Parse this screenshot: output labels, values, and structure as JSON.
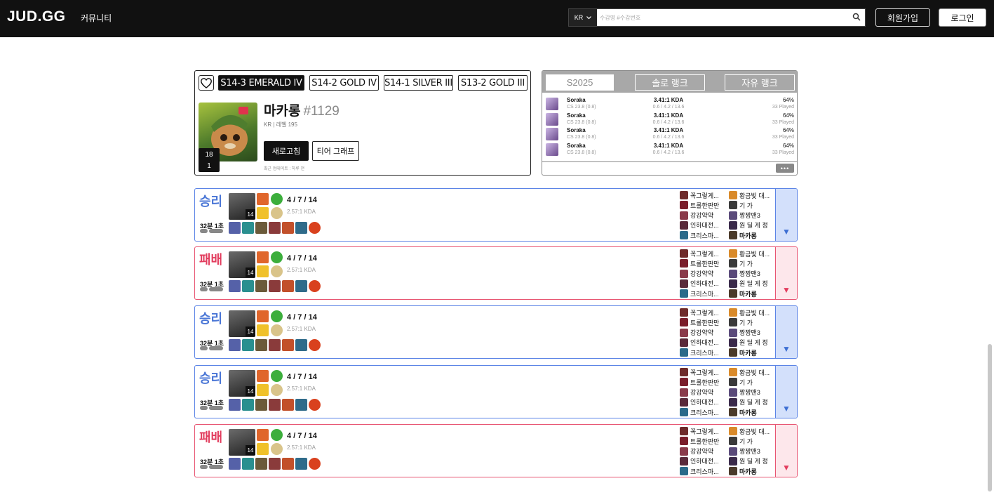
{
  "header": {
    "logo": "JUD.GG",
    "community": "커뮤니티",
    "region": "KR",
    "search_placeholder": "수감명 #수감번호",
    "signup": "회원가입",
    "login": "로그인"
  },
  "profile": {
    "tiers": [
      "S14-3 EMERALD IV",
      "S14-2 GOLD IV",
      "S14-1 SILVER III",
      "S13-2 GOLD III"
    ],
    "name": "마카롱",
    "tag": "#1129",
    "meta": "KR | 레벨 195",
    "level_top": "18",
    "level_bottom": "1",
    "refresh": "새로고침",
    "tier_graph": "티어 그래프",
    "updated": "최근 업데이트 : 하루 전"
  },
  "ranks": {
    "tabs": [
      "S2025",
      "솔로 랭크",
      "자유 랭크"
    ],
    "more": "•••",
    "champions": [
      {
        "name": "Soraka",
        "cs": "CS 23.8 (0.8)",
        "kda": "3.41:1 KDA",
        "kda_detail": "0.6 / 4.2 / 13.6",
        "winrate": "64%",
        "played": "33 Played"
      },
      {
        "name": "Soraka",
        "cs": "CS 23.8 (0.8)",
        "kda": "3.41:1 KDA",
        "kda_detail": "0.6 / 4.2 / 13.6",
        "winrate": "64%",
        "played": "33 Played"
      },
      {
        "name": "Soraka",
        "cs": "CS 23.8 (0.8)",
        "kda": "3.41:1 KDA",
        "kda_detail": "0.6 / 4.2 / 13.6",
        "winrate": "64%",
        "played": "33 Played"
      },
      {
        "name": "Soraka",
        "cs": "CS 23.8 (0.8)",
        "kda": "3.41:1 KDA",
        "kda_detail": "0.6 / 4.2 / 13.6",
        "winrate": "64%",
        "played": "33 Played"
      }
    ]
  },
  "matches": [
    {
      "result": "승리",
      "type": "win",
      "duration": "32분 1초",
      "champ_level": "14",
      "kda": "4 / 7 / 14",
      "ratio": "2.57:1 KDA",
      "toggle": "▼"
    },
    {
      "result": "패배",
      "type": "loss",
      "duration": "32분 1초",
      "champ_level": "14",
      "kda": "4 / 7 / 14",
      "ratio": "2.57:1 KDA",
      "toggle": "▼"
    },
    {
      "result": "승리",
      "type": "win",
      "duration": "32분 1초",
      "champ_level": "14",
      "kda": "4 / 7 / 14",
      "ratio": "2.57:1 KDA",
      "toggle": "▼"
    },
    {
      "result": "승리",
      "type": "win",
      "duration": "32분 1초",
      "champ_level": "14",
      "kda": "4 / 7 / 14",
      "ratio": "2.57:1 KDA",
      "toggle": "▼"
    },
    {
      "result": "패배",
      "type": "loss",
      "duration": "32분 1초",
      "champ_level": "14",
      "kda": "4 / 7 / 14",
      "ratio": "2.57:1 KDA",
      "toggle": "▼"
    }
  ],
  "team_blue": [
    "꼭그렇게...",
    "트롤한판만",
    "강강약약",
    "인하대전...",
    "크리스마..."
  ],
  "team_red": [
    "황금빛 대...",
    "기 가",
    "짱짱맨3",
    "원 딜 게 정",
    "마카롱"
  ],
  "colors": {
    "win": "#4a76d6",
    "loss": "#e23d5e",
    "win_bg": "#d3e0fb",
    "loss_bg": "#fde7eb"
  }
}
